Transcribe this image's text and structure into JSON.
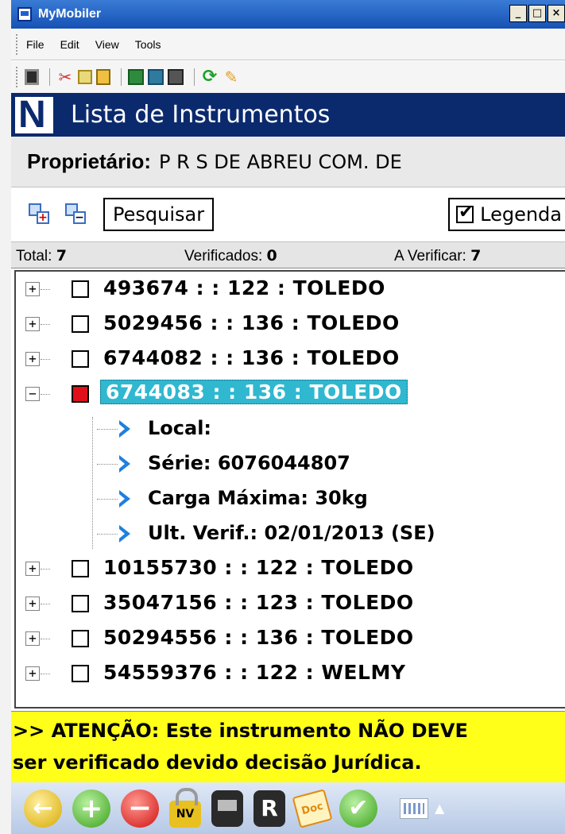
{
  "window": {
    "title": "MyMobiler",
    "controls": [
      "_",
      "□",
      "×"
    ]
  },
  "menu": [
    "File",
    "Edit",
    "View",
    "Tools"
  ],
  "app": {
    "title": "Lista de Instrumentos",
    "logo_letter": "N"
  },
  "owner": {
    "label": "Proprietário:",
    "value": "P R S DE ABREU COM. DE"
  },
  "actions": {
    "search_label": "Pesquisar",
    "legend_label": "Legenda",
    "legend_checked": true
  },
  "stats": {
    "total_label": "Total:",
    "total_value": "7",
    "verified_label": "Verificados:",
    "verified_value": "0",
    "pending_label": "A Verificar:",
    "pending_value": "7"
  },
  "tree": {
    "items": [
      {
        "label": "493674 :   : 122 : TOLEDO",
        "expanded": false,
        "checked": false
      },
      {
        "label": "5029456 :   : 136 : TOLEDO",
        "expanded": false,
        "checked": false
      },
      {
        "label": "6744082 :   : 136 : TOLEDO",
        "expanded": false,
        "checked": false
      },
      {
        "label": "6744083 :   : 136 : TOLEDO",
        "expanded": true,
        "checked": true,
        "selected": true
      },
      {
        "label": "10155730 :   : 122 : TOLEDO",
        "expanded": false,
        "checked": false
      },
      {
        "label": "35047156 :   : 123 : TOLEDO",
        "expanded": false,
        "checked": false
      },
      {
        "label": "50294556 :   : 136 : TOLEDO",
        "expanded": false,
        "checked": false
      },
      {
        "label": "54559376 :   : 122 : WELMY",
        "expanded": false,
        "checked": false
      }
    ],
    "children": [
      "Local:",
      "Série: 6076044807",
      "Carga Máxima: 30kg",
      "Ult. Verif.: 02/01/2013 (SE)"
    ]
  },
  "alert": {
    "line1": ">> ATENÇÃO: Este instrumento NÃO DEVE",
    "line2": "ser verificado devido decisão Jurídica.",
    "color": "#ffff1a"
  },
  "bottom": {
    "lock_label": "NV",
    "reg_label": "R",
    "doc_label": "Doc"
  },
  "colors": {
    "header": "#0b2a6e",
    "selection": "#2fb8cf",
    "checked": "#e0101a"
  }
}
